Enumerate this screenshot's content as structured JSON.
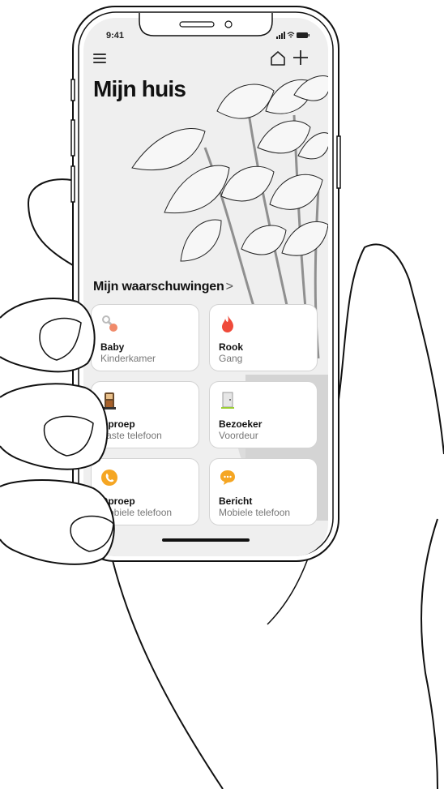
{
  "status_bar": {
    "time": "9:41"
  },
  "header": {
    "title": "Mijn huis",
    "menu_icon": "hamburger-icon",
    "home_icon": "house-icon",
    "add_icon": "plus-icon"
  },
  "alerts": {
    "section_label": "Mijn waarschuwingen",
    "chevron": ">",
    "cards": [
      {
        "title": "Baby",
        "subtitle": "Kinderkamer",
        "icon": "baby-pacifier-icon",
        "color": "#f08a6a"
      },
      {
        "title": "Rook",
        "subtitle": "Gang",
        "icon": "flame-icon",
        "color": "#ef4a3a"
      },
      {
        "title": "Oproep",
        "subtitle": "Vaste telefoon",
        "icon": "landline-phone-icon",
        "color": "#a6602a"
      },
      {
        "title": "Bezoeker",
        "subtitle": "Voordeur",
        "icon": "door-icon",
        "color": "#9acd32"
      },
      {
        "title": "Oproep",
        "subtitle": "Mobiele telefoon",
        "icon": "phone-call-icon",
        "color": "#f5a623"
      },
      {
        "title": "Bericht",
        "subtitle": "Mobiele telefoon",
        "icon": "chat-bubble-icon",
        "color": "#f5a623"
      }
    ]
  }
}
